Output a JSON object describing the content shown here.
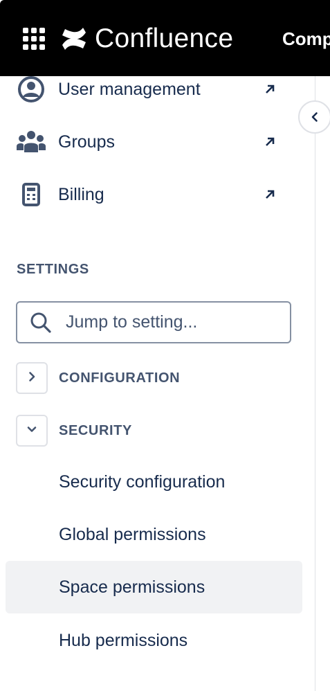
{
  "header": {
    "app_name": "Confluence",
    "truncated_nav_label": "Comp",
    "apps_icon": "app-switcher-grid-icon",
    "logo_icon": "confluence-logo-icon",
    "background": "#000000"
  },
  "sidebar": {
    "collapse_icon": "chevron-left-icon",
    "links": [
      {
        "label": "User management",
        "icon": "user-circle-icon",
        "trailing_icon": "arrow-up-right-icon"
      },
      {
        "label": "Groups",
        "icon": "people-group-icon",
        "trailing_icon": "arrow-up-right-icon"
      },
      {
        "label": "Billing",
        "icon": "calculator-icon",
        "trailing_icon": "arrow-up-right-icon"
      }
    ],
    "settings": {
      "section_label": "SETTINGS",
      "search_placeholder": "Jump to setting...",
      "search_icon": "search-icon",
      "groups": [
        {
          "label": "CONFIGURATION",
          "expanded": false,
          "icon": "chevron-right-icon"
        },
        {
          "label": "SECURITY",
          "expanded": true,
          "icon": "chevron-down-icon",
          "items": [
            {
              "label": "Security configuration",
              "selected": false
            },
            {
              "label": "Global permissions",
              "selected": false
            },
            {
              "label": "Space permissions",
              "selected": true
            },
            {
              "label": "Hub permissions",
              "selected": false
            }
          ]
        }
      ]
    }
  },
  "colors": {
    "text_primary": "#172B4D",
    "text_subtle": "#44546F",
    "border": "#DFE1E6",
    "selected_bg": "#F1F2F4"
  }
}
